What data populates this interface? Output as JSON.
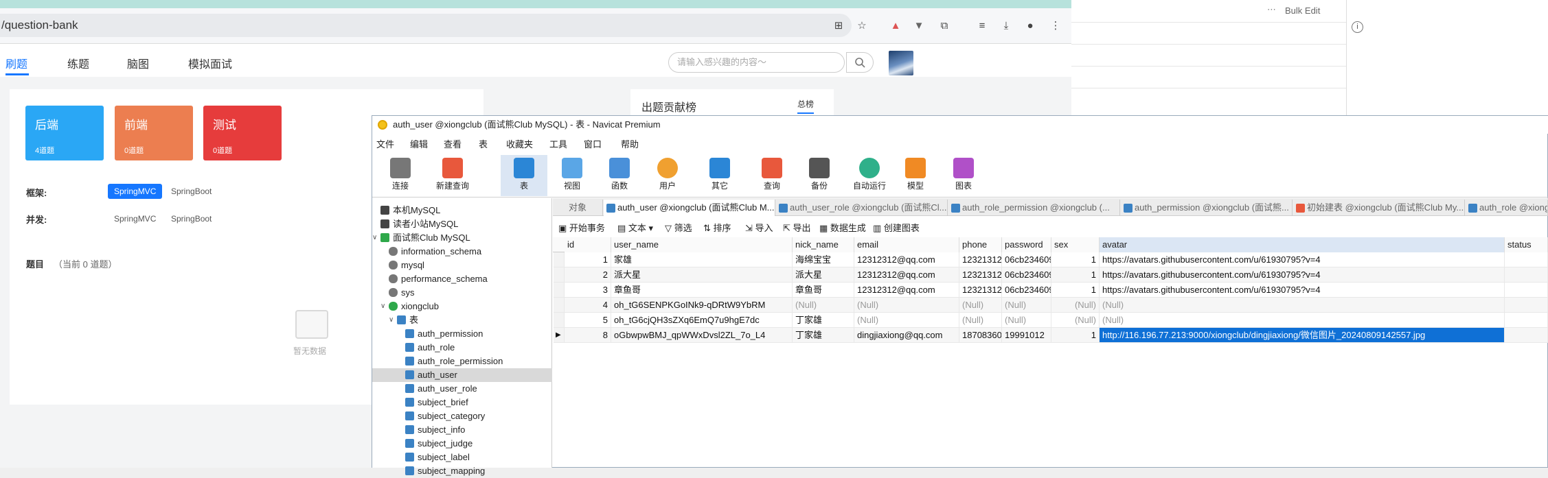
{
  "browser": {
    "url": "/question-bank"
  },
  "right_pane": {
    "bulk_edit": "Bulk Edit",
    "dots": "⋯"
  },
  "site": {
    "nav": [
      "刷题",
      "练题",
      "脑图",
      "模拟面试"
    ],
    "search_placeholder": "请输入感兴趣的内容～",
    "categories": [
      {
        "name": "后端",
        "count": "4道题",
        "color": "#2aa7f5"
      },
      {
        "name": "前端",
        "count": "0道题",
        "color": "#ec7e50"
      },
      {
        "name": "测试",
        "count": "0道题",
        "color": "#e63c3c"
      }
    ],
    "framework_label": "框架:",
    "framework_tags": [
      "SpringMVC",
      "SpringBoot"
    ],
    "concurrency_label": "并发:",
    "concurrency_tags": [
      "SpringMVC",
      "SpringBoot"
    ],
    "topic_label": "题目",
    "topic_count": "（当前 0 道题）",
    "empty_text": "暂无数据",
    "contrib_title": "出题贡献榜",
    "contrib_tab": "总榜"
  },
  "navicat": {
    "title": "auth_user @xiongclub (面试熊Club MySQL) - 表 - Navicat Premium",
    "menu": [
      "文件",
      "编辑",
      "查看",
      "表",
      "收藏夹",
      "工具",
      "窗口",
      "帮助"
    ],
    "toolbar": [
      {
        "label": "连接",
        "color": "#555"
      },
      {
        "label": "新建查询",
        "color": "#e8583c"
      },
      {
        "label": "表",
        "color": "#2b86d6"
      },
      {
        "label": "视图",
        "color": "#2b86d6"
      },
      {
        "label": "函数",
        "color": "#2b86d6"
      },
      {
        "label": "用户",
        "color": "#f0a030"
      },
      {
        "label": "其它",
        "color": "#2b86d6"
      },
      {
        "label": "查询",
        "color": "#e8583c"
      },
      {
        "label": "备份",
        "color": "#555"
      },
      {
        "label": "自动运行",
        "color": "#2fb08a"
      },
      {
        "label": "模型",
        "color": "#f08a24"
      },
      {
        "label": "图表",
        "color": "#b050c8"
      }
    ],
    "tree": [
      {
        "label": "本机MySQL",
        "indent": 0,
        "kind": "conn"
      },
      {
        "label": "读者小站MySQL",
        "indent": 0,
        "kind": "conn"
      },
      {
        "label": "面试熊Club MySQL",
        "indent": 0,
        "kind": "conn-open"
      },
      {
        "label": "information_schema",
        "indent": 1,
        "kind": "db"
      },
      {
        "label": "mysql",
        "indent": 1,
        "kind": "db"
      },
      {
        "label": "performance_schema",
        "indent": 1,
        "kind": "db"
      },
      {
        "label": "sys",
        "indent": 1,
        "kind": "db"
      },
      {
        "label": "xiongclub",
        "indent": 1,
        "kind": "db-open"
      },
      {
        "label": "表",
        "indent": 2,
        "kind": "folder"
      },
      {
        "label": "auth_permission",
        "indent": 3,
        "kind": "table"
      },
      {
        "label": "auth_role",
        "indent": 3,
        "kind": "table"
      },
      {
        "label": "auth_role_permission",
        "indent": 3,
        "kind": "table"
      },
      {
        "label": "auth_user",
        "indent": 3,
        "kind": "table",
        "selected": true
      },
      {
        "label": "auth_user_role",
        "indent": 3,
        "kind": "table"
      },
      {
        "label": "subject_brief",
        "indent": 3,
        "kind": "table"
      },
      {
        "label": "subject_category",
        "indent": 3,
        "kind": "table"
      },
      {
        "label": "subject_info",
        "indent": 3,
        "kind": "table"
      },
      {
        "label": "subject_judge",
        "indent": 3,
        "kind": "table"
      },
      {
        "label": "subject_label",
        "indent": 3,
        "kind": "table"
      },
      {
        "label": "subject_mapping",
        "indent": 3,
        "kind": "table"
      }
    ],
    "tabs": [
      {
        "label": "对象",
        "icon": false
      },
      {
        "label": "auth_user @xiongclub (面试熊Club M...",
        "icon": true,
        "active": true
      },
      {
        "label": "auth_user_role @xiongclub (面试熊Cl...",
        "icon": true
      },
      {
        "label": "auth_role_permission @xiongclub (...",
        "icon": true
      },
      {
        "label": "auth_permission @xiongclub (面试熊...",
        "icon": true
      },
      {
        "label": "初始建表 @xiongclub (面试熊Club My...",
        "icon": true
      },
      {
        "label": "auth_role @xiongc",
        "icon": true
      }
    ],
    "data_toolbar": [
      "开始事务",
      "文本",
      "筛选",
      "排序",
      "导入",
      "导出",
      "数据生成",
      "创建图表"
    ],
    "columns": [
      "id",
      "user_name",
      "nick_name",
      "email",
      "phone",
      "password",
      "sex",
      "avatar",
      "status"
    ],
    "rows": [
      [
        "1",
        "家雄",
        "海绵宝宝",
        "12312312@qq.com",
        "12321312",
        "06cb234609",
        "1",
        "https://avatars.githubusercontent.com/u/61930795?v=4",
        ""
      ],
      [
        "2",
        "派大星",
        "派大星",
        "12312312@qq.com",
        "12321312",
        "06cb234609",
        "1",
        "https://avatars.githubusercontent.com/u/61930795?v=4",
        ""
      ],
      [
        "3",
        "章鱼哥",
        "章鱼哥",
        "12312312@qq.com",
        "12321312",
        "06cb234609",
        "1",
        "https://avatars.githubusercontent.com/u/61930795?v=4",
        ""
      ],
      [
        "4",
        "oh_tG6SENPKGoINk9-qDRtW9YbRM",
        "(Null)",
        "(Null)",
        "(Null)",
        "(Null)",
        "(Null)",
        "(Null)",
        ""
      ],
      [
        "5",
        "oh_tG6cjQH3sZXq6EmQ7u9hgE7dc",
        "丁家雄",
        "(Null)",
        "(Null)",
        "(Null)",
        "(Null)",
        "(Null)",
        ""
      ],
      [
        "8",
        "oGbwpwBMJ_qpWWxDvsl2ZL_7o_L4",
        "丁家雄",
        "dingjiaxiong@qq.com",
        "18708360",
        "19991012",
        "1",
        "http://116.196.77.213:9000/xiongclub/dingjiaxiong/微信图片_20240809142557.jpg",
        ""
      ]
    ]
  }
}
